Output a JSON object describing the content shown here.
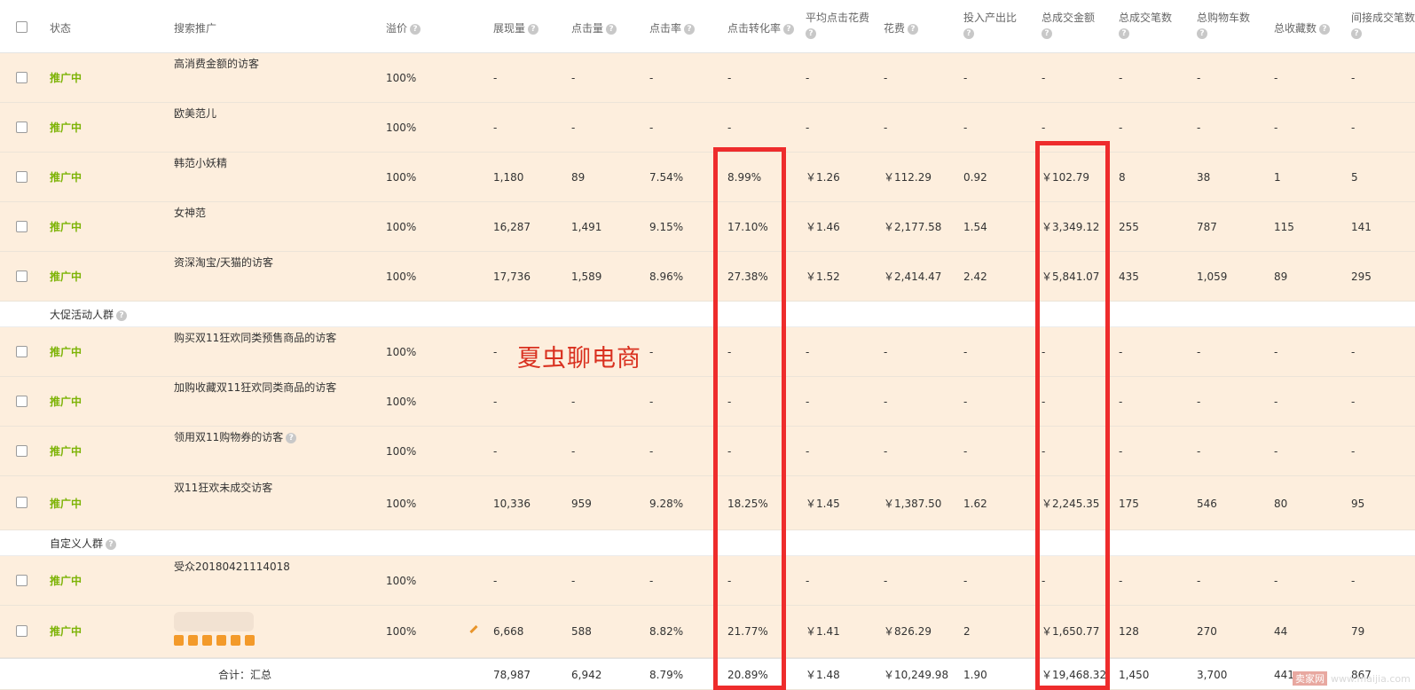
{
  "headers": {
    "status": "状态",
    "search": "搜索推广",
    "premium": "溢价",
    "impressions": "展现量",
    "clicks": "点击量",
    "ctr": "点击率",
    "cvr": "点击转化率",
    "avg_cpc": "平均点击花费",
    "cost": "花费",
    "roi": "投入产出比",
    "gmv": "总成交金额",
    "orders": "总成交笔数",
    "carts": "总购物车数",
    "favorites": "总收藏数",
    "indirect_orders": "间接成交笔数"
  },
  "rows": [
    {
      "status": "推广中",
      "name": "高消费金额的访客",
      "premium": "100%",
      "impressions": "-",
      "clicks": "-",
      "ctr": "-",
      "cvr": "-",
      "avg_cpc": "-",
      "cost": "-",
      "roi": "-",
      "gmv": "-",
      "orders": "-",
      "carts": "-",
      "favorites": "-",
      "indirect_orders": "-"
    },
    {
      "status": "推广中",
      "name": "欧美范儿",
      "premium": "100%",
      "impressions": "-",
      "clicks": "-",
      "ctr": "-",
      "cvr": "-",
      "avg_cpc": "-",
      "cost": "-",
      "roi": "-",
      "gmv": "-",
      "orders": "-",
      "carts": "-",
      "favorites": "-",
      "indirect_orders": "-"
    },
    {
      "status": "推广中",
      "name": "韩范小妖精",
      "premium": "100%",
      "impressions": "1,180",
      "clicks": "89",
      "ctr": "7.54%",
      "cvr": "8.99%",
      "avg_cpc": "￥1.26",
      "cost": "￥112.29",
      "roi": "0.92",
      "gmv": "￥102.79",
      "orders": "8",
      "carts": "38",
      "favorites": "1",
      "indirect_orders": "5"
    },
    {
      "status": "推广中",
      "name": "女神范",
      "premium": "100%",
      "impressions": "16,287",
      "clicks": "1,491",
      "ctr": "9.15%",
      "cvr": "17.10%",
      "avg_cpc": "￥1.46",
      "cost": "￥2,177.58",
      "roi": "1.54",
      "gmv": "￥3,349.12",
      "orders": "255",
      "carts": "787",
      "favorites": "115",
      "indirect_orders": "141"
    },
    {
      "status": "推广中",
      "name": "资深淘宝/天猫的访客",
      "premium": "100%",
      "impressions": "17,736",
      "clicks": "1,589",
      "ctr": "8.96%",
      "cvr": "27.38%",
      "avg_cpc": "￥1.52",
      "cost": "￥2,414.47",
      "roi": "2.42",
      "gmv": "￥5,841.07",
      "orders": "435",
      "carts": "1,059",
      "favorites": "89",
      "indirect_orders": "295"
    }
  ],
  "group_promo": {
    "label": "大促活动人群"
  },
  "rows_promo": [
    {
      "status": "推广中",
      "name": "购买双11狂欢同类预售商品的访客",
      "premium": "100%",
      "impressions": "-",
      "clicks": "-",
      "ctr": "-",
      "cvr": "-",
      "avg_cpc": "-",
      "cost": "-",
      "roi": "-",
      "gmv": "-",
      "orders": "-",
      "carts": "-",
      "favorites": "-",
      "indirect_orders": "-"
    },
    {
      "status": "推广中",
      "name": "加购收藏双11狂欢同类商品的访客",
      "premium": "100%",
      "impressions": "-",
      "clicks": "-",
      "ctr": "-",
      "cvr": "-",
      "avg_cpc": "-",
      "cost": "-",
      "roi": "-",
      "gmv": "-",
      "orders": "-",
      "carts": "-",
      "favorites": "-",
      "indirect_orders": "-"
    },
    {
      "status": "推广中",
      "name": "领用双11购物券的访客",
      "premium": "100%",
      "impressions": "-",
      "clicks": "-",
      "ctr": "-",
      "cvr": "-",
      "avg_cpc": "-",
      "cost": "-",
      "roi": "-",
      "gmv": "-",
      "orders": "-",
      "carts": "-",
      "favorites": "-",
      "indirect_orders": "-"
    },
    {
      "status": "推广中",
      "name": "双11狂欢未成交访客",
      "premium": "100%",
      "impressions": "10,336",
      "clicks": "959",
      "ctr": "9.28%",
      "cvr": "18.25%",
      "avg_cpc": "￥1.45",
      "cost": "￥1,387.50",
      "roi": "1.62",
      "gmv": "￥2,245.35",
      "orders": "175",
      "carts": "546",
      "favorites": "80",
      "indirect_orders": "95"
    }
  ],
  "group_custom": {
    "label": "自定义人群"
  },
  "rows_custom": [
    {
      "status": "推广中",
      "name": "受众20180421114018",
      "premium": "100%",
      "impressions": "-",
      "clicks": "-",
      "ctr": "-",
      "cvr": "-",
      "avg_cpc": "-",
      "cost": "-",
      "roi": "-",
      "gmv": "-",
      "orders": "-",
      "carts": "-",
      "favorites": "-",
      "indirect_orders": "-"
    },
    {
      "status": "推广中",
      "name": "",
      "premium": "100%",
      "impressions": "6,668",
      "clicks": "588",
      "ctr": "8.82%",
      "cvr": "21.77%",
      "avg_cpc": "￥1.41",
      "cost": "￥826.29",
      "roi": "2",
      "gmv": "￥1,650.77",
      "orders": "128",
      "carts": "270",
      "favorites": "44",
      "indirect_orders": "79"
    }
  ],
  "total": {
    "label": "合计：汇总",
    "impressions": "78,987",
    "clicks": "6,942",
    "ctr": "8.79%",
    "cvr": "20.89%",
    "avg_cpc": "￥1.48",
    "cost": "￥10,249.98",
    "roi": "1.90",
    "gmv": "￥19,468.32",
    "orders": "1,450",
    "carts": "3,700",
    "favorites": "441",
    "indirect_orders": "867"
  },
  "watermark": "夏虫聊电商",
  "site_logo": {
    "badge": "卖家网",
    "url_text": "www.maijia.com"
  },
  "colors": {
    "status_active": "#7cb305",
    "row_background": "#fdeedd",
    "highlight_box": "#ee2c2c"
  }
}
